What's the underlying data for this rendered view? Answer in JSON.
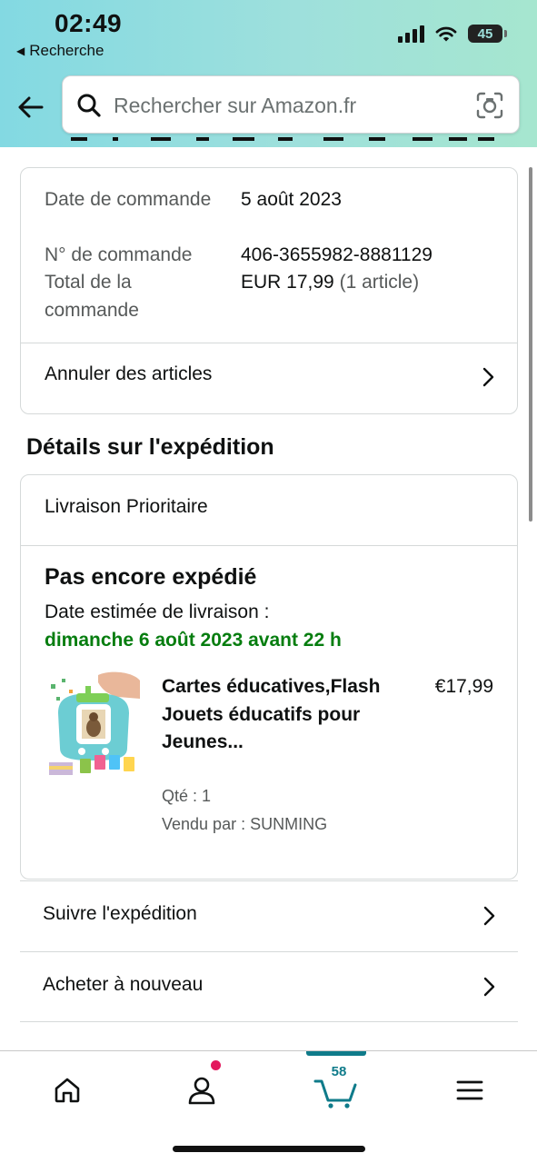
{
  "status_bar": {
    "time": "02:49",
    "back_app": "Recherche",
    "battery": "45"
  },
  "search": {
    "placeholder": "Rechercher sur Amazon.fr"
  },
  "order_summary": {
    "date_label": "Date de commande",
    "date_value": "5 août 2023",
    "number_label": "N° de commande",
    "number_value": "406-3655982-8881129",
    "total_label": "Total de la commande",
    "total_value": "EUR 17,99",
    "total_items": "(1 article)",
    "cancel_label": "Annuler des articles"
  },
  "shipment": {
    "section_title": "Détails sur l'expédition",
    "method": "Livraison Prioritaire",
    "status": "Pas encore expédié",
    "estimate_label": "Date estimée de livraison :",
    "estimate_date": "dimanche 6 août 2023 avant 22 h",
    "item": {
      "title": "Cartes éducatives,Flash Jouets éducatifs pour Jeunes...",
      "price": "€17,99",
      "qty": "Qté : 1",
      "seller": "Vendu par : SUNMING"
    }
  },
  "actions": {
    "track": "Suivre l'expédition",
    "buy_again": "Acheter à nouveau"
  },
  "bottom_nav": {
    "cart_count": "58"
  },
  "colors": {
    "header_gradient_start": "#83d9e2",
    "header_gradient_end": "#a6e6cf",
    "delivery_green": "#067d0f",
    "cart_teal": "#0f7b8a",
    "notification_pink": "#e3185d"
  }
}
